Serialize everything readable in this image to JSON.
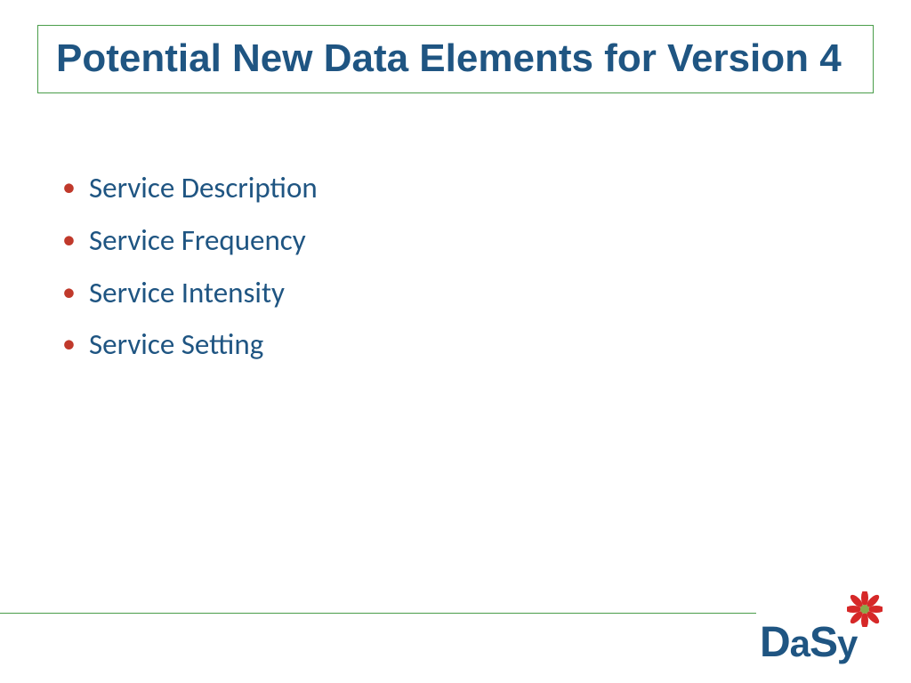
{
  "title": "Potential New Data Elements for Version 4",
  "bullets": {
    "0": "Service Description",
    "1": "Service Frequency",
    "2": "Service Intensity",
    "3": "Service Setting"
  },
  "logo": {
    "text_part1": "D",
    "text_part2": "a",
    "text_part3": "S",
    "text_part4": "y"
  },
  "colors": {
    "title_text": "#1f5582",
    "border_green": "#4a9d4a",
    "bullet_red": "#c0392b",
    "flower_red": "#d62828",
    "flower_center": "#6b8e23"
  }
}
